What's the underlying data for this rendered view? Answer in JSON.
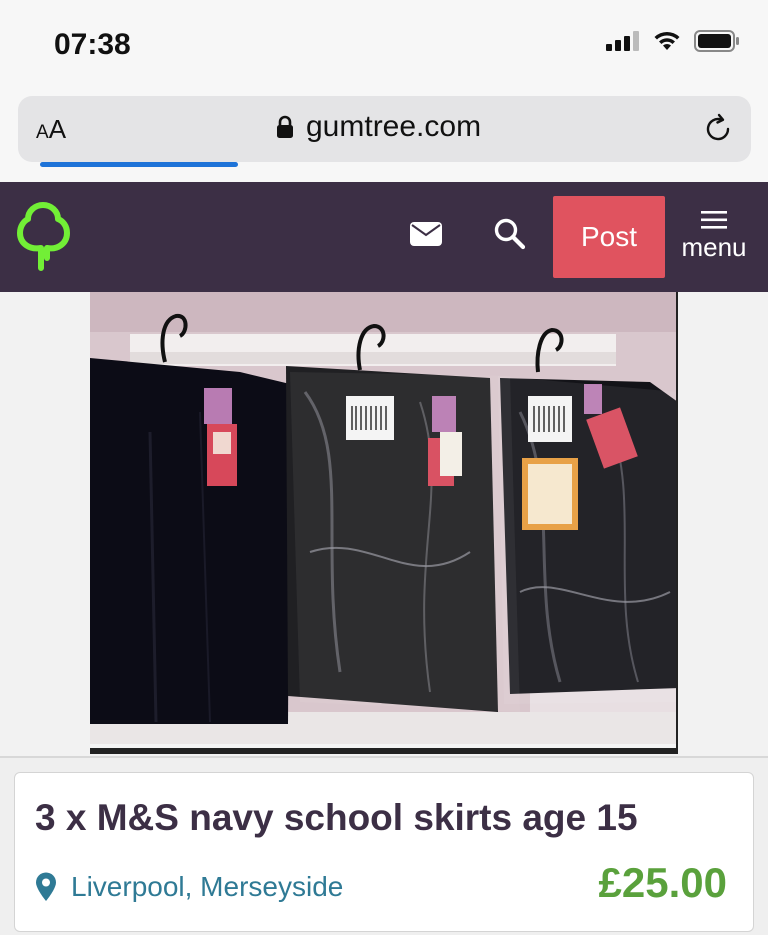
{
  "status_bar": {
    "time": "07:38"
  },
  "browser": {
    "text_size_small": "A",
    "text_size_large": "A",
    "url": "gumtree.com",
    "load_progress": 0.27
  },
  "header": {
    "post_label": "Post",
    "menu_label": "menu",
    "background": "#3c2f45",
    "post_color": "#e0535f",
    "logo_color": "#72ef36"
  },
  "listing": {
    "title": "3 x M&S navy school skirts age 15",
    "location": "Liverpool, Merseyside",
    "price": "£25.00",
    "price_color": "#5aa13c",
    "location_color": "#2f7a95"
  }
}
